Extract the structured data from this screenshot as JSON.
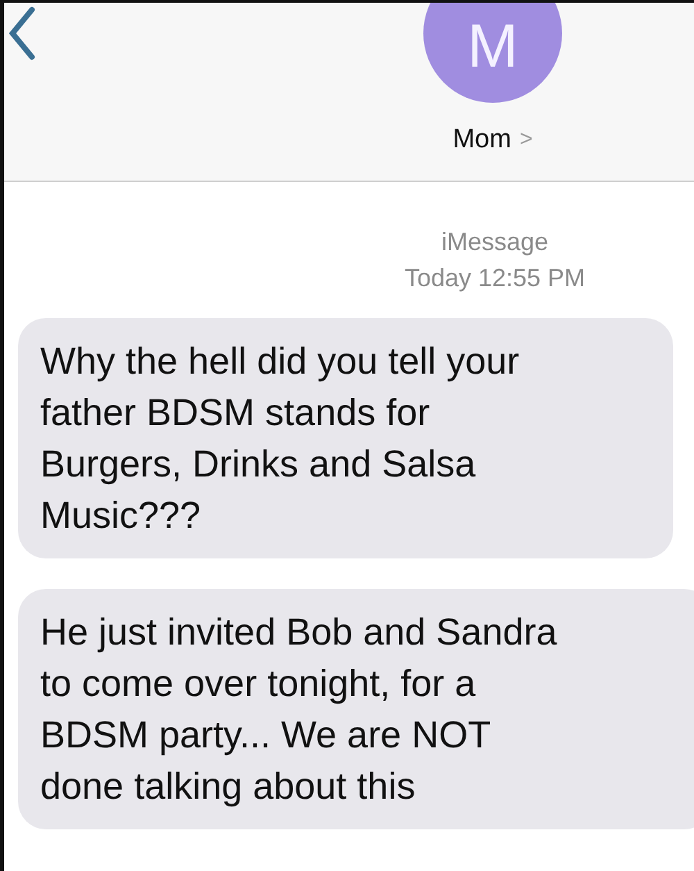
{
  "header": {
    "avatar_letter": "M",
    "contact": "Mom",
    "contact_chevron": ">"
  },
  "thread_info": {
    "service": "iMessage",
    "timestamp": "Today 12:55 PM"
  },
  "messages": [
    {
      "kind": "received",
      "text": "Why the hell did you tell your\nfather BDSM stands for\nBurgers, Drinks and Salsa\nMusic???"
    },
    {
      "kind": "received",
      "text": "He just invited Bob and Sandra\nto come over tonight, for a\nBDSM party... We are NOT\ndone talking about this"
    }
  ]
}
